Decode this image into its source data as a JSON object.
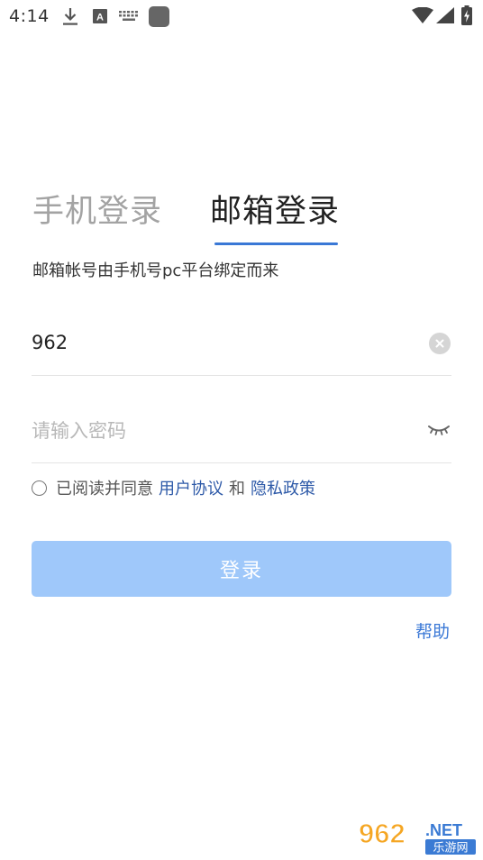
{
  "status_bar": {
    "time": "4:14",
    "a_badge": "A"
  },
  "tabs": {
    "phone_login": "手机登录",
    "email_login": "邮箱登录"
  },
  "hint": "邮箱帐号由手机号pc平台绑定而来",
  "email_field": {
    "value": "962"
  },
  "password_field": {
    "placeholder": "请输入密码"
  },
  "agreement": {
    "prefix": "已阅读并同意",
    "user_agreement": "用户协议",
    "and": "和",
    "privacy_policy": "隐私政策"
  },
  "login_button": "登录",
  "help": "帮助",
  "watermark": {
    "number": "962",
    "suffix": ".NET",
    "subtitle": "乐游网"
  },
  "colors": {
    "accent": "#3a78d6",
    "link": "#2e5aa8",
    "button_disabled": "#9fc8fa"
  },
  "icons": [
    "download-icon",
    "a-badge-icon",
    "keyboard-icon",
    "app-square-icon",
    "wifi-icon",
    "signal-icon",
    "battery-charging-icon",
    "clear-icon",
    "eye-closed-icon",
    "radio-unchecked-icon"
  ]
}
